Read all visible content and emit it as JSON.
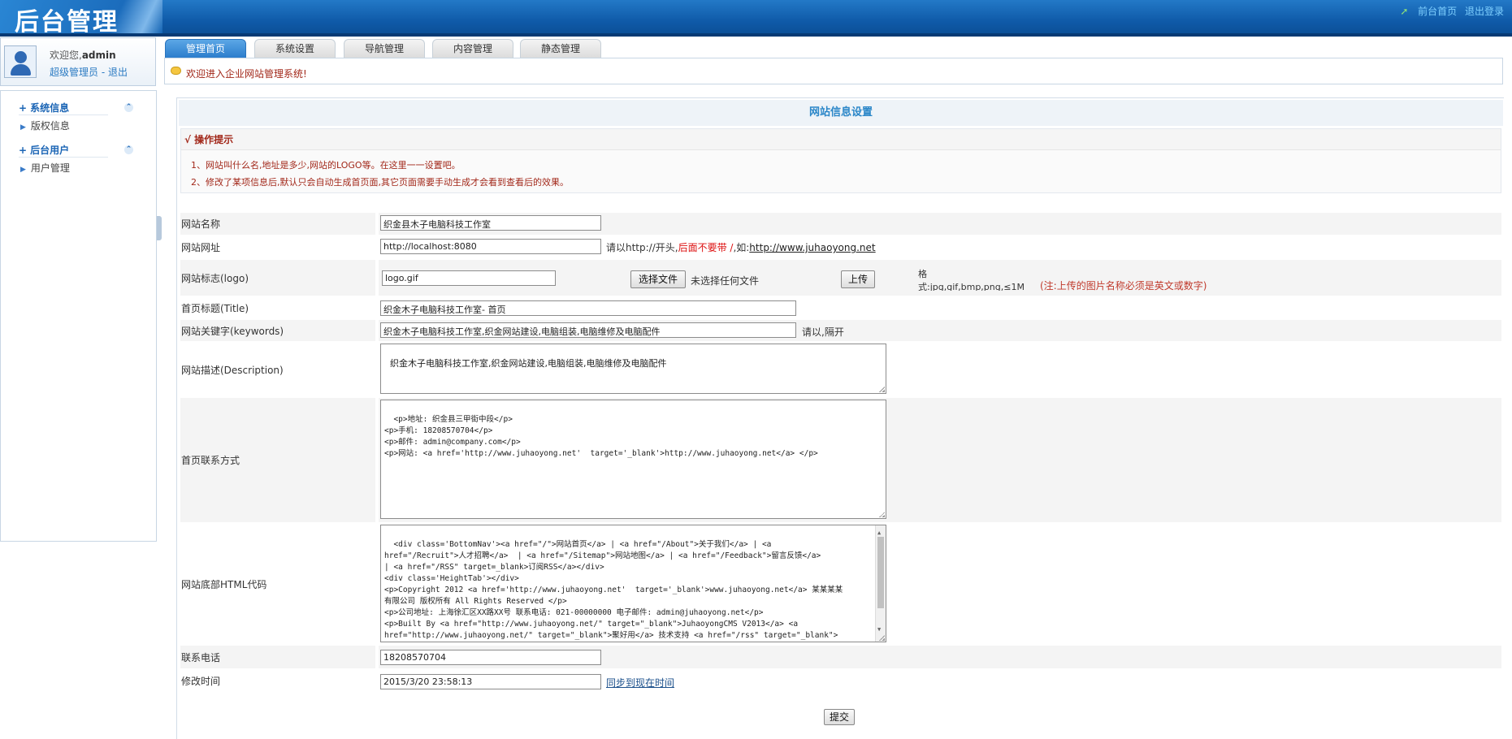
{
  "header": {
    "logo_text": "后台管理",
    "links": [
      "前台首页",
      "退出登录"
    ]
  },
  "user": {
    "welcome_prefix": "欢迎您,",
    "username": "admin",
    "role_text": "超级管理员 - 退出"
  },
  "sidebar": {
    "groups": [
      {
        "title": "系统信息",
        "items": [
          "版权信息"
        ]
      },
      {
        "title": "后台用户",
        "items": [
          "用户管理"
        ]
      }
    ]
  },
  "tabs": [
    "管理首页",
    "系统设置",
    "导航管理",
    "内容管理",
    "静态管理"
  ],
  "notice": "欢迎进入企业网站管理系统!",
  "main": {
    "title": "网站信息设置",
    "tips_title": "√ 操作提示",
    "tips": [
      "1、网站叫什么名,地址是多少,网站的LOGO等。在这里一一设置吧。",
      "2、修改了某项信息后,默认只会自动生成首页面,其它页面需要手动生成才会看到查看后的效果。"
    ]
  },
  "form": {
    "site_name": {
      "label": "网站名称",
      "value": "织金县木子电脑科技工作室"
    },
    "site_url": {
      "label": "网站网址",
      "value": "http://localhost:8080",
      "hint_a": "请以http://开头,",
      "hint_red": "后面不要带 /",
      "hint_b": ",如:",
      "hint_link": "http://www.juhaoyong.net"
    },
    "logo": {
      "label": "网站标志(logo)",
      "value": "logo.gif",
      "choose_btn": "选择文件",
      "no_file": "未选择任何文件",
      "upload_btn": "上传",
      "format_note": "格式:jpg,gif,bmp,png,≤1M",
      "warn": "(注:上传的图片名称必须是英文或数字)"
    },
    "home_title": {
      "label": "首页标题(Title)",
      "value": "织金木子电脑科技工作室- 首页"
    },
    "keywords": {
      "label": "网站关键字(keywords)",
      "value": "织金木子电脑科技工作室,织金网站建设,电脑组装,电脑维修及电脑配件",
      "hint": "请以,隔开"
    },
    "description": {
      "label": "网站描述(Description)",
      "value": "织金木子电脑科技工作室,织金网站建设,电脑组装,电脑维修及电脑配件"
    },
    "contact": {
      "label": "首页联系方式",
      "value": "<p>地址: 织金县三甲街中段</p>\n<p>手机: 18208570704</p>\n<p>邮件: admin@company.com</p>\n<p>网站: <a href='http://www.juhaoyong.net'  target='_blank'>http://www.juhaoyong.net</a> </p>"
    },
    "footer_html": {
      "label": "网站底部HTML代码",
      "value": "<div class='BottomNav'><a href=\"/\">网站首页</a> | <a href=\"/About\">关于我们</a> | <a\nhref=\"/Recruit\">人才招聘</a>  | <a href=\"/Sitemap\">网站地图</a> | <a href=\"/Feedback\">留言反馈</a>\n| <a href=\"/RSS\" target=_blank>订阅RSS</a></div>\n<div class='HeightTab'></div>\n<p>Copyright 2012 <a href='http://www.juhaoyong.net'  target='_blank'>www.juhaoyong.net</a> 某某某某\n有限公司 版权所有 All Rights Reserved </p>\n<p>公司地址: 上海徐汇区XX路XX号 联系电话: 021-00000000 电子邮件: admin@juhaoyong.net</p>\n<p>Built By <a href=\"http://www.juhaoyong.net/\" target=\"_blank\">JuhaoyongCMS V2013</a> <a\nhref=\"http://www.juhaoyong.net/\" target=\"_blank\">聚好用</a> 技术支持 <a href=\"/rss\" target=\"_blank\">\n<img src=\"/images/rss_icon.gif\"></a> <a href=\"/rss\" target=\"_blank\"><img src=\"/images/xml_icon.gif\">"
    },
    "phone": {
      "label": "联系电话",
      "value": "18208570704"
    },
    "modified": {
      "label": "修改时间",
      "value": "2015/3/20 23:58:13",
      "sync_link": "同步到现在时间"
    },
    "submit": "提交"
  }
}
